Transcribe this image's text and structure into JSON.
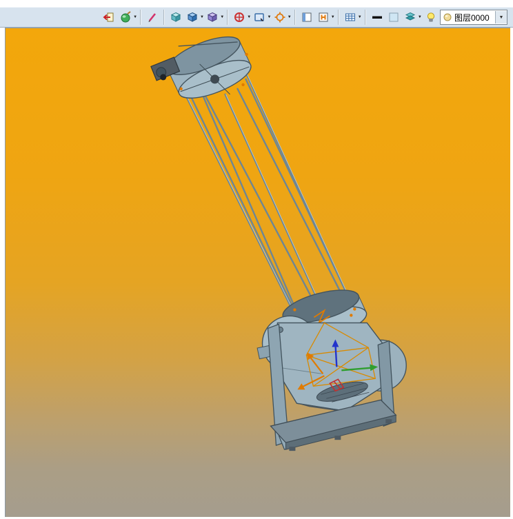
{
  "app": {
    "name": "3D CAD modeling viewport"
  },
  "toolbar": {
    "bg": "#d7e3ee",
    "items": [
      {
        "name": "exit-render-button",
        "icon": "exit-render-icon",
        "dropdown": false
      },
      {
        "name": "appearance-button",
        "icon": "appearance-icon",
        "dropdown": true
      },
      {
        "name": "annotate-tool-button",
        "icon": "pen-icon",
        "dropdown": false
      },
      {
        "name": "isometric-view-button",
        "icon": "teal-cube-icon",
        "dropdown": false
      },
      {
        "name": "view-cube-button",
        "icon": "blue-cube-icon",
        "dropdown": true
      },
      {
        "name": "display-mode-button",
        "icon": "violet-cube-icon",
        "dropdown": true
      },
      {
        "name": "orbit-button",
        "icon": "red-wheel-icon",
        "dropdown": true
      },
      {
        "name": "zoom-window-button",
        "icon": "selection-rect-icon",
        "dropdown": true
      },
      {
        "name": "locate-center-button",
        "icon": "orange-crosshair-icon",
        "dropdown": true
      },
      {
        "name": "viewport-layout-button",
        "icon": "panel-icon",
        "dropdown": false
      },
      {
        "name": "named-view-button",
        "icon": "h-panel-icon",
        "dropdown": true
      },
      {
        "name": "table-button",
        "icon": "table-grid-icon",
        "dropdown": true
      },
      {
        "name": "line-width-button",
        "icon": "thick-line-icon",
        "dropdown": false
      },
      {
        "name": "background-color-button",
        "icon": "color-swatch-icon",
        "dropdown": false
      },
      {
        "name": "layers-button",
        "icon": "layers-icon",
        "dropdown": true
      },
      {
        "name": "layer-visibility-bulb",
        "icon": "lightbulb-icon",
        "dropdown": false
      }
    ],
    "layer_combo": {
      "value": "图层0000",
      "icon": "layer-sphere-icon"
    }
  },
  "viewport": {
    "gradient_top": "#f3a70b",
    "gradient_bottom": "#a59d8e",
    "model": "truss-tube Dobsonian telescope assembly",
    "model_color": "#a6bcc8",
    "edge_color": "#44545e",
    "axis_colors": {
      "x": "#e07b00",
      "y": "#2f9e2f",
      "z": "#2233cc"
    },
    "selection_color": "#d98a00"
  }
}
